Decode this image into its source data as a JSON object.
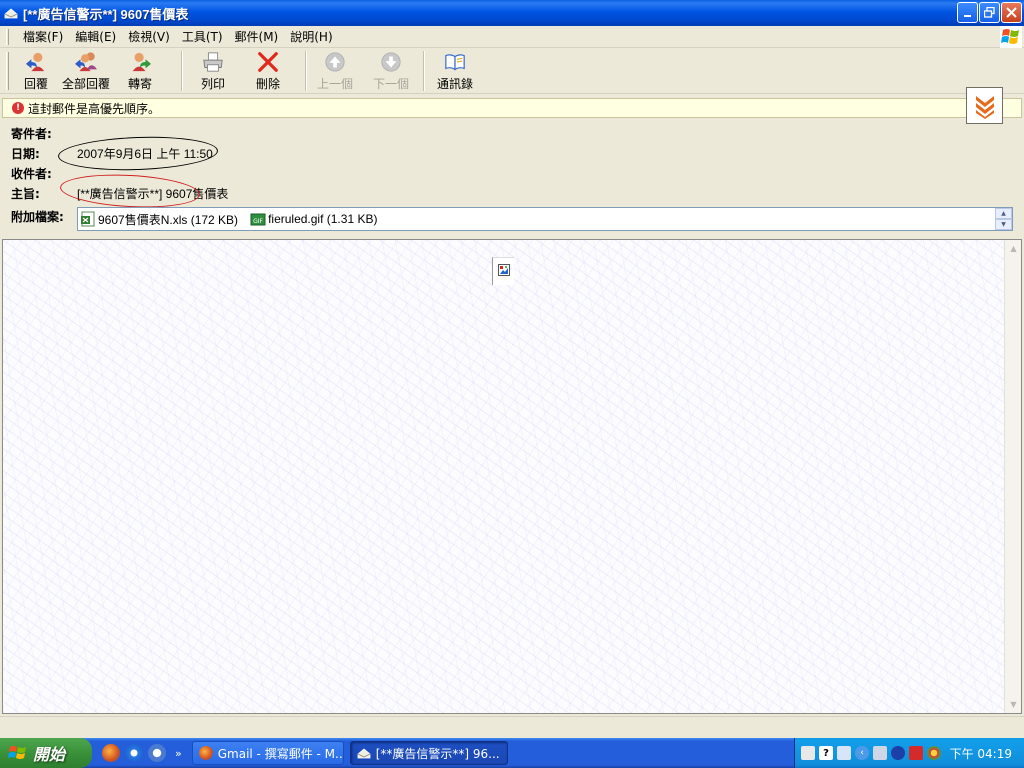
{
  "window": {
    "title": "[**廣告信警示**] 9607售價表",
    "buttons": {
      "minimize": "_",
      "maximize": "❐",
      "close": "✕"
    }
  },
  "menubar": {
    "items": [
      "檔案(F)",
      "編輯(E)",
      "檢視(V)",
      "工具(T)",
      "郵件(M)",
      "說明(H)"
    ]
  },
  "toolbar": {
    "buttons": [
      {
        "label": "回覆",
        "icon": "reply-icon",
        "enabled": true
      },
      {
        "label": "全部回覆",
        "icon": "reply-all-icon",
        "enabled": true
      },
      {
        "label": "轉寄",
        "icon": "forward-icon",
        "enabled": true
      },
      {
        "label": "列印",
        "icon": "print-icon",
        "enabled": true
      },
      {
        "label": "刪除",
        "icon": "delete-icon",
        "enabled": true
      },
      {
        "label": "上一個",
        "icon": "previous-icon",
        "enabled": false
      },
      {
        "label": "下一個",
        "icon": "next-icon",
        "enabled": false
      },
      {
        "label": "通訊錄",
        "icon": "address-book-icon",
        "enabled": true
      }
    ]
  },
  "priority_bar": {
    "text": "這封郵件是高優先順序。"
  },
  "header": {
    "from_label": "寄件者:",
    "from_value": "",
    "date_label": "日期:",
    "date_value": "2007年9月6日 上午 11:50",
    "to_label": "收件者:",
    "to_value": "",
    "subject_label": "主旨:",
    "subject_value": "[**廣告信警示**] 9607售價表",
    "attach_label": "附加檔案:"
  },
  "attachments": [
    {
      "name": "9607售價表N.xls (172 KB)",
      "icon": "excel-file-icon"
    },
    {
      "name": "fieruled.gif (1.31 KB)",
      "icon": "gif-file-icon"
    }
  ],
  "taskbar": {
    "start_label": "開始",
    "tasks": [
      {
        "label": "Gmail - 撰寫郵件 - M...",
        "active": false,
        "icon": "firefox-icon"
      },
      {
        "label": "[**廣告信警示**] 96...",
        "active": true,
        "icon": "mail-icon"
      }
    ],
    "quicklaunch_more": "»",
    "clock": "下午 04:19"
  },
  "colors": {
    "title_bar": "#0054e3",
    "annotation_black": "#000000",
    "annotation_red": "#d02020",
    "priority_bg": "#ffffe1"
  }
}
